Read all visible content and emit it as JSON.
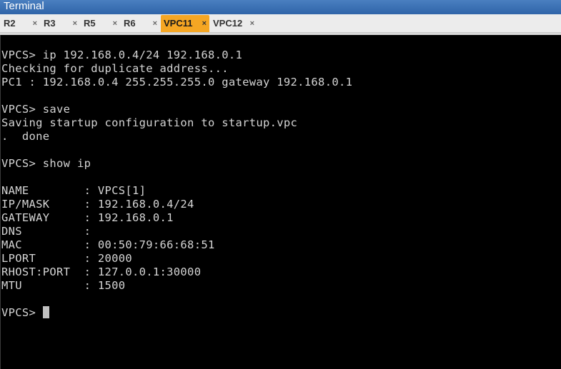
{
  "window": {
    "title": "Terminal"
  },
  "tabs": [
    {
      "label": "R2",
      "close": "×",
      "active": false
    },
    {
      "label": "R3",
      "close": "×",
      "active": false
    },
    {
      "label": "R5",
      "close": "×",
      "active": false
    },
    {
      "label": "R6",
      "close": "×",
      "active": false
    },
    {
      "label": "VPC11",
      "close": "×",
      "active": true
    },
    {
      "label": "VPC12",
      "close": "×",
      "active": false
    }
  ],
  "terminal": {
    "lines": [
      "VPCS> ip 192.168.0.4/24 192.168.0.1",
      "Checking for duplicate address...",
      "PC1 : 192.168.0.4 255.255.255.0 gateway 192.168.0.1",
      "",
      "VPCS> save",
      "Saving startup configuration to startup.vpc",
      ".  done",
      "",
      "VPCS> show ip",
      "",
      "NAME        : VPCS[1]",
      "IP/MASK     : 192.168.0.4/24",
      "GATEWAY     : 192.168.0.1",
      "DNS         :",
      "MAC         : 00:50:79:66:68:51",
      "LPORT       : 20000",
      "RHOST:PORT  : 127.0.0.1:30000",
      "MTU         : 1500",
      ""
    ],
    "prompt": "VPCS> "
  },
  "colors": {
    "active_tab": "#f5a623",
    "terminal_bg": "#000000",
    "terminal_fg": "#d4d4d4",
    "titlebar": "#3a6fb4"
  }
}
